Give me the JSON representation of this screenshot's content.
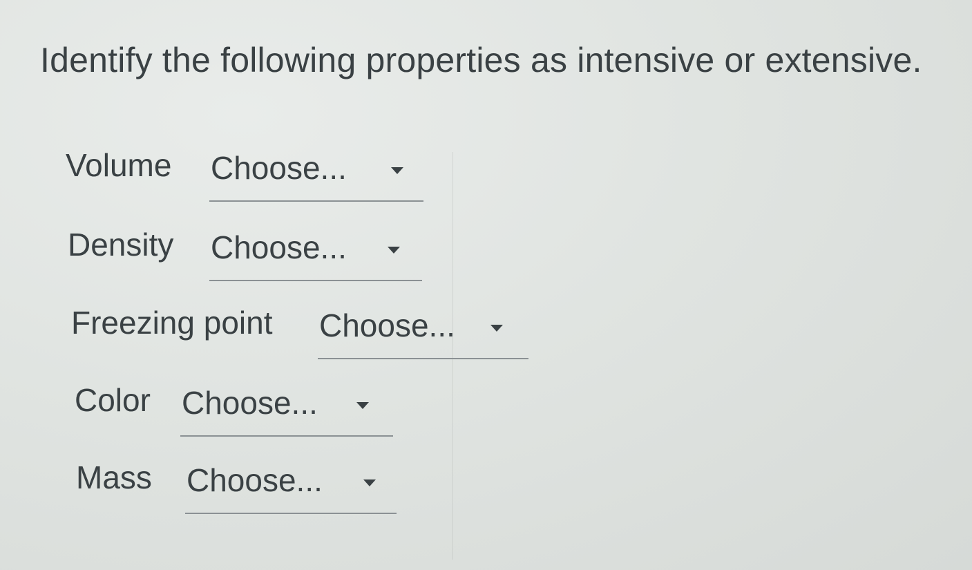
{
  "question": "Identify the following properties as intensive or extensive.",
  "items": [
    {
      "label": "Volume",
      "selected": "Choose..."
    },
    {
      "label": "Density",
      "selected": "Choose..."
    },
    {
      "label": "Freezing point",
      "selected": "Choose..."
    },
    {
      "label": "Color",
      "selected": "Choose..."
    },
    {
      "label": "Mass",
      "selected": "Choose..."
    }
  ],
  "icons": {
    "caret": "chevron-down-icon"
  },
  "colors": {
    "background": "#e0e4e1",
    "text": "#3a4144",
    "underline": "#8b9194"
  }
}
